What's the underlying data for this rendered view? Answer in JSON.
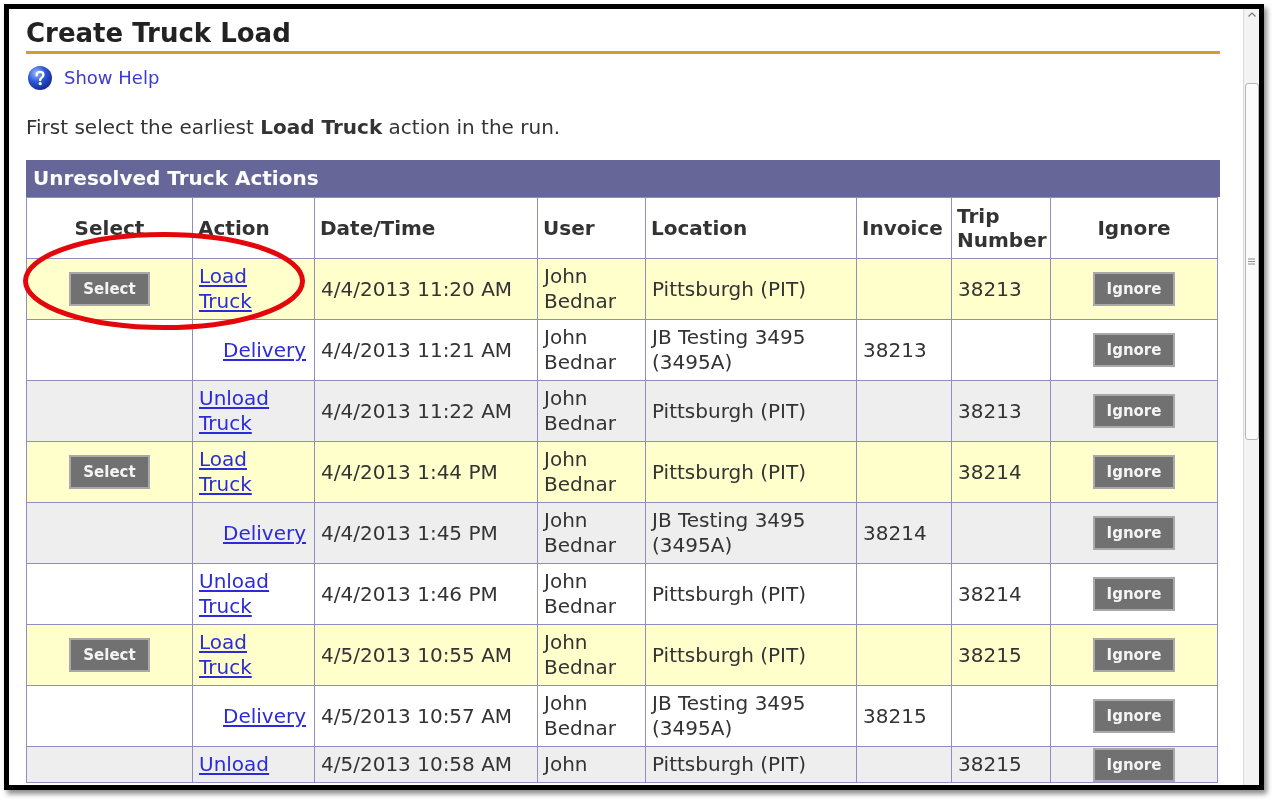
{
  "page": {
    "title": "Create Truck Load",
    "help_link": "Show Help",
    "instruction": "First select the earliest **Load Truck** action in the run."
  },
  "table": {
    "caption": "Unresolved Truck Actions",
    "columns": [
      "Select",
      "Action",
      "Date/Time",
      "User",
      "Location",
      "Invoice",
      "Trip Number",
      "Ignore"
    ],
    "rows": [
      {
        "highlighted": true,
        "circled": true,
        "select_button": "Select",
        "action": "Load Truck",
        "indented": false,
        "date_time": "4/4/2013 11:20 AM",
        "user": "John Bednar",
        "location": "Pittsburgh (PIT)",
        "trip_number": "38213",
        "ignore_button": "Ignore"
      },
      {
        "highlighted": false,
        "circled": false,
        "action": "Delivery",
        "indented": true,
        "date_time": "4/4/2013 11:21 AM",
        "user": "John Bednar",
        "location": "JB Testing 3495 (3495A)",
        "invoice": "38213",
        "ignore_button": "Ignore"
      },
      {
        "highlighted": false,
        "circled": false,
        "action": "Unload Truck",
        "indented": false,
        "date_time": "4/4/2013 11:22 AM",
        "user": "John Bednar",
        "location": "Pittsburgh (PIT)",
        "trip_number": "38213",
        "ignore_button": "Ignore"
      },
      {
        "highlighted": true,
        "circled": false,
        "select_button": "Select",
        "action": "Load Truck",
        "indented": false,
        "date_time": "4/4/2013 1:44 PM",
        "user": "John Bednar",
        "location": "Pittsburgh (PIT)",
        "trip_number": "38214",
        "ignore_button": "Ignore"
      },
      {
        "highlighted": false,
        "circled": false,
        "action": "Delivery",
        "indented": true,
        "date_time": "4/4/2013 1:45 PM",
        "user": "John Bednar",
        "location": "JB Testing 3495 (3495A)",
        "invoice": "38214",
        "ignore_button": "Ignore"
      },
      {
        "highlighted": false,
        "circled": false,
        "action": "Unload Truck",
        "indented": false,
        "date_time": "4/4/2013 1:46 PM",
        "user": "John Bednar",
        "location": "Pittsburgh (PIT)",
        "trip_number": "38214",
        "ignore_button": "Ignore"
      },
      {
        "highlighted": true,
        "circled": false,
        "select_button": "Select",
        "action": "Load Truck",
        "indented": false,
        "date_time": "4/5/2013 10:55 AM",
        "user": "John Bednar",
        "location": "Pittsburgh (PIT)",
        "trip_number": "38215",
        "ignore_button": "Ignore"
      },
      {
        "highlighted": false,
        "circled": false,
        "action": "Delivery",
        "indented": true,
        "date_time": "4/5/2013 10:57 AM",
        "user": "John Bednar",
        "location": "JB Testing 3495 (3495A)",
        "invoice": "38215",
        "ignore_button": "Ignore"
      },
      {
        "highlighted": false,
        "circled": false,
        "action": "Unload",
        "indented": false,
        "date_time": "4/5/2013 10:58 AM",
        "user": "John",
        "location": "Pittsburgh (PIT)",
        "trip_number": "38215",
        "ignore_button": "Ignore"
      }
    ]
  }
}
